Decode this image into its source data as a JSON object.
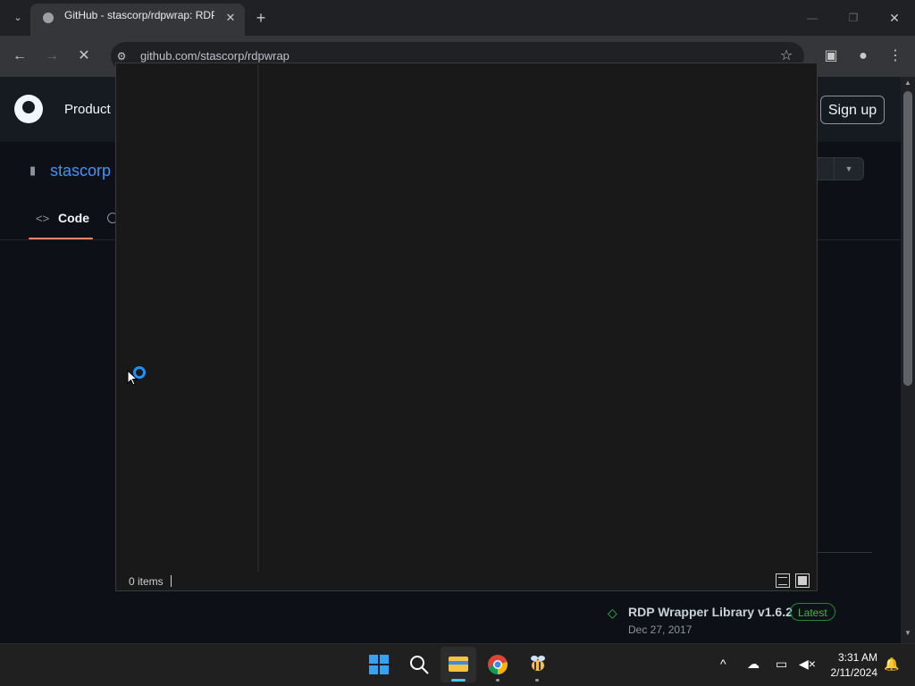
{
  "browser": {
    "tab_title": "GitHub - stascorp/rdpwrap: RDP",
    "url": "github.com/stascorp/rdpwrap"
  },
  "github": {
    "nav_product": "Product",
    "signup_label": "Sign up",
    "repo_owner": "stascorp",
    "code_tab": "Code",
    "release": {
      "title": "RDP Wrapper Library v1.6.2",
      "badge": "Latest",
      "date": "Dec 27, 2017"
    }
  },
  "dialog": {
    "status_items": "0 items"
  },
  "taskbar": {
    "time": "3:31 AM",
    "date": "2/11/2024"
  },
  "colors": {
    "accent_link": "#4493f8",
    "tab_underline": "#f78166",
    "latest_green": "#3fb950",
    "spinner_blue": "#1e90ff"
  }
}
